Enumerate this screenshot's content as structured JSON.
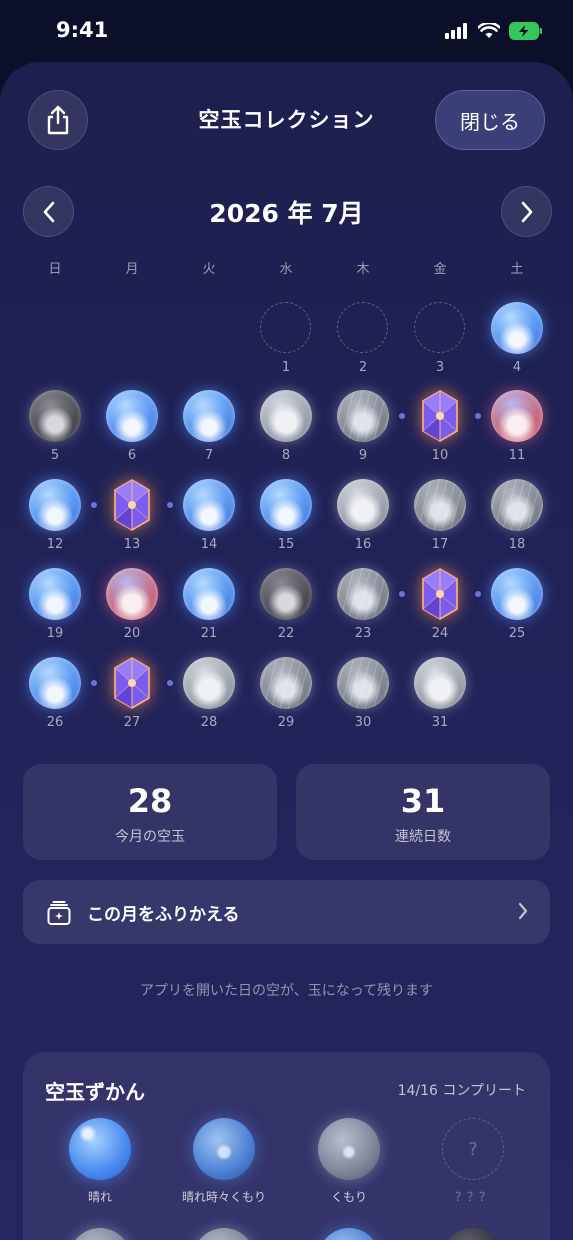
{
  "status_bar": {
    "time": "9:41"
  },
  "header": {
    "title": "空玉コレクション",
    "close_label": "閉じる"
  },
  "month_nav": {
    "label": "2026 年 7月"
  },
  "weekdays": [
    "日",
    "月",
    "火",
    "水",
    "木",
    "金",
    "土"
  ],
  "calendar": {
    "days": [
      {
        "day": "1",
        "type": "empty"
      },
      {
        "day": "2",
        "type": "empty"
      },
      {
        "day": "3",
        "type": "empty"
      },
      {
        "day": "4",
        "type": "clear"
      },
      {
        "day": "5",
        "type": "night"
      },
      {
        "day": "6",
        "type": "clear"
      },
      {
        "day": "7",
        "type": "clear"
      },
      {
        "day": "8",
        "type": "cloudy"
      },
      {
        "day": "9",
        "type": "rain"
      },
      {
        "day": "10",
        "type": "gem"
      },
      {
        "day": "11",
        "type": "sunset"
      },
      {
        "day": "12",
        "type": "clear"
      },
      {
        "day": "13",
        "type": "gem"
      },
      {
        "day": "14",
        "type": "clear"
      },
      {
        "day": "15",
        "type": "clear"
      },
      {
        "day": "16",
        "type": "cloudy"
      },
      {
        "day": "17",
        "type": "rain"
      },
      {
        "day": "18",
        "type": "rain"
      },
      {
        "day": "19",
        "type": "clear"
      },
      {
        "day": "20",
        "type": "sunset"
      },
      {
        "day": "21",
        "type": "clear"
      },
      {
        "day": "22",
        "type": "night"
      },
      {
        "day": "23",
        "type": "rain"
      },
      {
        "day": "24",
        "type": "gem"
      },
      {
        "day": "25",
        "type": "clear"
      },
      {
        "day": "26",
        "type": "clear"
      },
      {
        "day": "27",
        "type": "gem"
      },
      {
        "day": "28",
        "type": "cloudy"
      },
      {
        "day": "29",
        "type": "rain"
      },
      {
        "day": "30",
        "type": "rain"
      },
      {
        "day": "31",
        "type": "cloudy"
      }
    ]
  },
  "stats": {
    "month_count": "28",
    "month_label": "今月の空玉",
    "streak_count": "31",
    "streak_label": "連続日数"
  },
  "review": {
    "label": "この月をふりかえる"
  },
  "hint": "アプリを開いた日の空が、玉になって残ります",
  "zukan": {
    "title": "空玉ずかん",
    "progress": "14/16 コンプリート",
    "items": [
      {
        "label": "晴れ",
        "type": "z-clear"
      },
      {
        "label": "晴れ時々くもり",
        "type": "z-partly"
      },
      {
        "label": "くもり",
        "type": "z-cloudy"
      },
      {
        "label": "？？？",
        "type": "z-unknown"
      }
    ]
  },
  "colors": {
    "accent_dot": "#6d73d8",
    "close_button": "#3b3f78",
    "gem_purple": "#8b5cf6",
    "gem_orange": "#ff8a50"
  }
}
